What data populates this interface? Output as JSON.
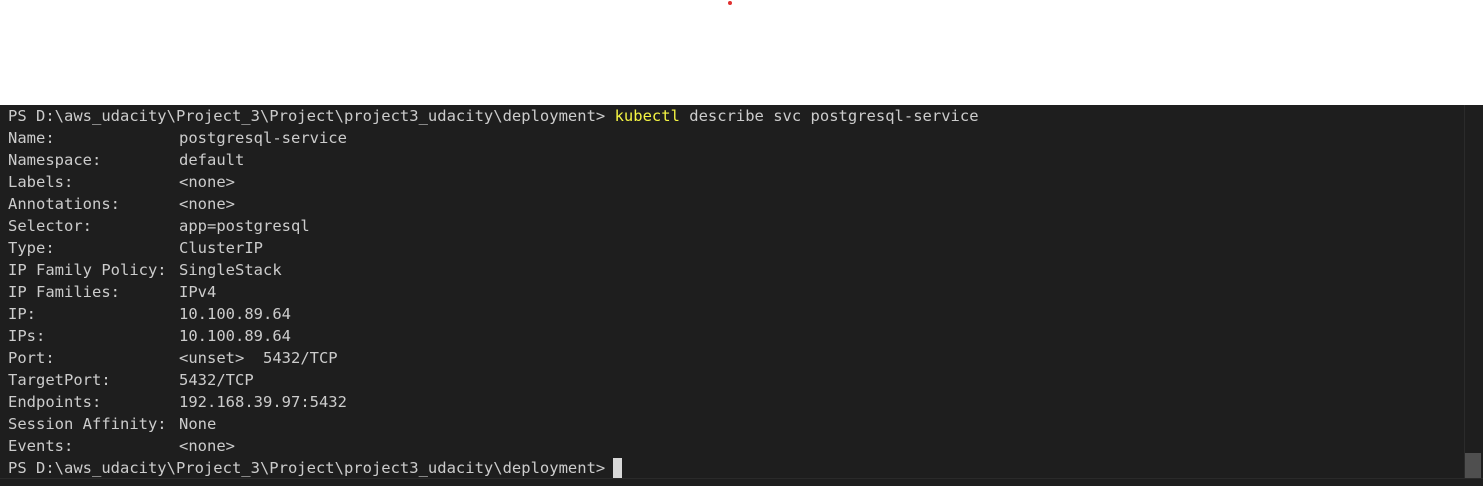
{
  "terminal": {
    "command_prompt": "PS D:\\aws_udacity\\Project_3\\Project\\project3_udacity\\deployment> ",
    "command_program": "kubectl",
    "command_args": " describe svc postgresql-service",
    "fields": [
      {
        "key": "Name:",
        "value": "postgresql-service"
      },
      {
        "key": "Namespace:",
        "value": "default"
      },
      {
        "key": "Labels:",
        "value": "<none>"
      },
      {
        "key": "Annotations:",
        "value": "<none>"
      },
      {
        "key": "Selector:",
        "value": "app=postgresql"
      },
      {
        "key": "Type:",
        "value": "ClusterIP"
      },
      {
        "key": "IP Family Policy:",
        "value": "SingleStack"
      },
      {
        "key": "IP Families:",
        "value": "IPv4"
      },
      {
        "key": "IP:",
        "value": "10.100.89.64"
      },
      {
        "key": "IPs:",
        "value": "10.100.89.64"
      },
      {
        "key": "Port:",
        "value": "<unset>  5432/TCP"
      },
      {
        "key": "TargetPort:",
        "value": "5432/TCP"
      },
      {
        "key": "Endpoints:",
        "value": "192.168.39.97:5432"
      },
      {
        "key": "Session Affinity:",
        "value": "None"
      },
      {
        "key": "Events:",
        "value": "<none>"
      }
    ],
    "final_prompt": "PS D:\\aws_udacity\\Project_3\\Project\\project3_udacity\\deployment>"
  },
  "colors": {
    "background": "#1e1e1e",
    "text": "#cccccc",
    "command_highlight": "#f5f543",
    "accent_dot": "#e03030"
  },
  "icons": {
    "cursor": "block-cursor-icon"
  }
}
